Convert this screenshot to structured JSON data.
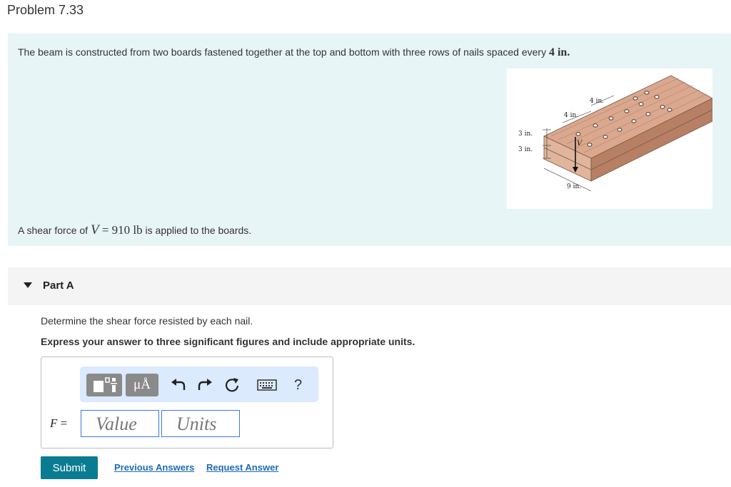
{
  "page": {
    "title": "Problem 7.33"
  },
  "intro": {
    "text_before": "The beam is constructed from two boards fastened together at the top and bottom with three rows of nails spaced every ",
    "spacing_math": "4 in.",
    "shear_before": "A shear force of ",
    "shear_var": "V",
    "shear_eq": " = ",
    "shear_value": "910 lb",
    "shear_after": " is applied to the boards."
  },
  "figure": {
    "dim_spacing_1": "4 in.",
    "dim_spacing_2": "4 in.",
    "dim_height_1": "3 in.",
    "dim_height_2": "3 in.",
    "dim_width": "9 in.",
    "force_label": "V",
    "colors": {
      "wood_top": "#d9a88e",
      "wood_side": "#c48f74",
      "wood_front": "#b77f63",
      "line": "#7a5a4a"
    }
  },
  "part": {
    "label": "Part A",
    "expanded_icon": "caret-down-icon"
  },
  "question": {
    "prompt": "Determine the shear force resisted by each nail.",
    "instruction": "Express your answer to three significant figures and include appropriate units."
  },
  "toolbar": {
    "templates_icon": "templates-icon",
    "symbols_label": "μÅ",
    "undo_icon": "undo-icon",
    "redo_icon": "redo-icon",
    "reset_icon": "reset-icon",
    "keyboard_icon": "keyboard-icon",
    "help_label": "?"
  },
  "answer": {
    "variable": "F",
    "equals": " =",
    "value_placeholder": "Value",
    "units_placeholder": "Units"
  },
  "actions": {
    "submit_label": "Submit",
    "previous_answers_label": "Previous Answers",
    "request_answer_label": "Request Answer"
  },
  "colors": {
    "intro_bg": "#e8f5f7",
    "submit_bg": "#0a7c92",
    "link": "#1e6bb8",
    "field_border": "#3a7bd5",
    "toolbar_bg": "#dbeafc"
  }
}
